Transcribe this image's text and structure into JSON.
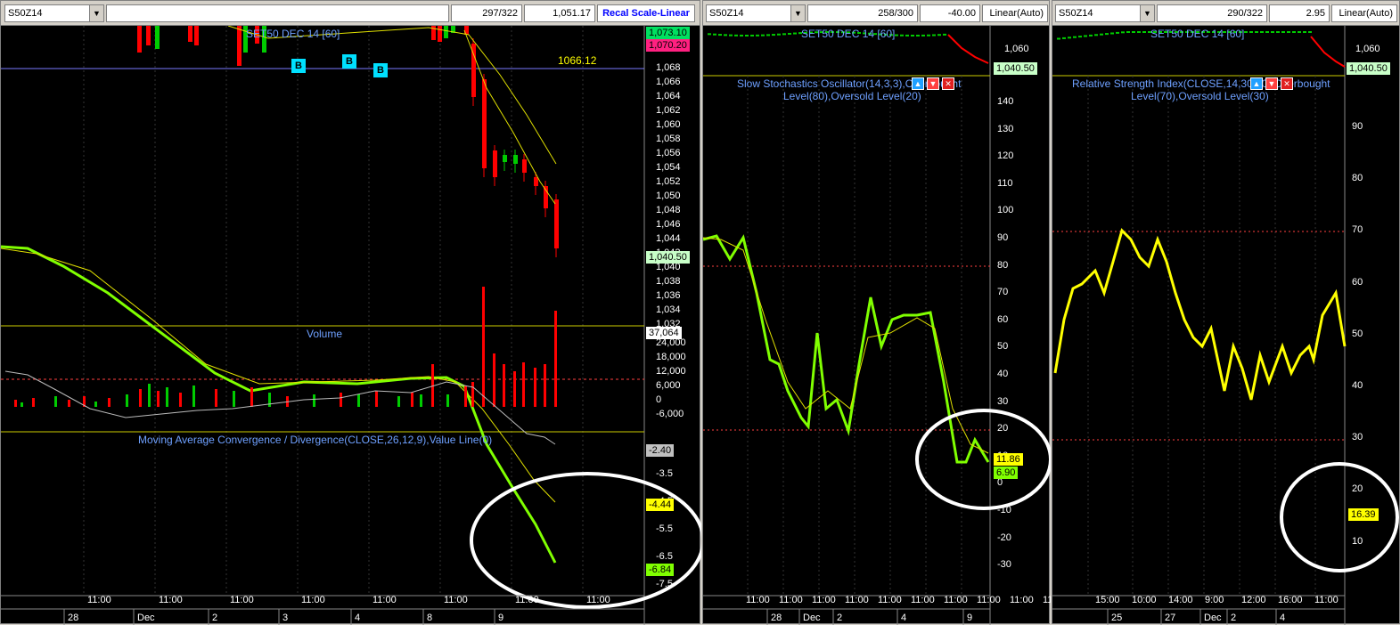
{
  "left": {
    "symbol": "S50Z14",
    "counter": "297/322",
    "price": "1,051.17",
    "scale_button": "Recal Scale-Linear",
    "title": "SET50 DEC 14   [60]",
    "hline_value": "1066.12",
    "buy_marker": "B",
    "price_axis": [
      "1,068",
      "1,066",
      "1,064",
      "1,062",
      "1,060",
      "1,058",
      "1,056",
      "1,054",
      "1,052",
      "1,050",
      "1,048",
      "1,046",
      "1,044",
      "1,042",
      "1,040",
      "1,038",
      "1,036",
      "1,034",
      "1,032"
    ],
    "price_tags": {
      "high": "1,073.10",
      "low": "1,070.20",
      "last": "1,040.50"
    },
    "volume_title": "Volume",
    "volume_axis": [
      "24,000",
      "18,000",
      "12,000",
      "6,000",
      "0",
      "-6,000"
    ],
    "volume_tag": "37,064",
    "macd_title": "Moving Average Convergence / Divergence(CLOSE,26,12,9),Value Line(0)",
    "macd_axis": [
      "-3.5",
      "-4.5",
      "-5.5",
      "-6.5",
      "-7.5"
    ],
    "macd_tags": {
      "a": "-2.40",
      "b": "-4.44",
      "c": "-6.84"
    },
    "x_times": [
      "11:00",
      "11:00",
      "11:00",
      "11:00",
      "11:00",
      "11:00",
      "11:00",
      "11:00"
    ],
    "x_dates": [
      "28",
      "Dec",
      "2",
      "3",
      "4",
      "8",
      "9"
    ]
  },
  "middle": {
    "symbol": "S50Z14",
    "counter": "258/300",
    "change": "-40.00",
    "scale": "Linear(Auto)",
    "title": "SET50 DEC 14   [60]",
    "price_axis": [
      "1,060"
    ],
    "price_tag": "1,040.50",
    "indicator_title_1": "Slow Stochastics Oscillator(14,3,3),Overbought",
    "indicator_title_2": "Level(80),Oversold Level(20)",
    "axis": [
      "140",
      "130",
      "120",
      "110",
      "100",
      "90",
      "80",
      "70",
      "60",
      "50",
      "40",
      "30",
      "20",
      "10",
      "0",
      "-10",
      "-20",
      "-30"
    ],
    "tags": {
      "a": "11.86",
      "b": "6.90"
    },
    "x_times": [
      "11:00",
      "11:00",
      "11:00",
      "11:00",
      "11:00",
      "11:00",
      "11:00",
      "11:00",
      "11:00",
      "11:00",
      "11:00",
      "11:00"
    ],
    "x_dates": [
      "28",
      "Dec",
      "2",
      "4",
      "9"
    ]
  },
  "right": {
    "symbol": "S50Z14",
    "counter": "290/322",
    "change": "2.95",
    "scale": "Linear(Auto)",
    "title": "SET50 DEC 14   [60]",
    "price_axis": [
      "1,060"
    ],
    "price_tag": "1,040.50",
    "indicator_title_1": "Relative Strength Index(CLOSE,14,30,70),Overbought",
    "indicator_title_2": "Level(70),Oversold Level(30)",
    "axis": [
      "90",
      "80",
      "70",
      "60",
      "50",
      "40",
      "30",
      "20",
      "10"
    ],
    "tag": "16.39",
    "x_times": [
      "15:00",
      "10:00",
      "14:00",
      "9:00",
      "12:00",
      "16:00",
      "11:00"
    ],
    "x_dates": [
      "25",
      "27",
      "Dec",
      "2",
      "4"
    ]
  },
  "colors": {
    "bg": "#000000",
    "up": "#00cc00",
    "down": "#ff0000",
    "fast": "#80ff00",
    "slow": "#e0e000",
    "rsi": "#ffff00",
    "guide": "#cccc00"
  }
}
